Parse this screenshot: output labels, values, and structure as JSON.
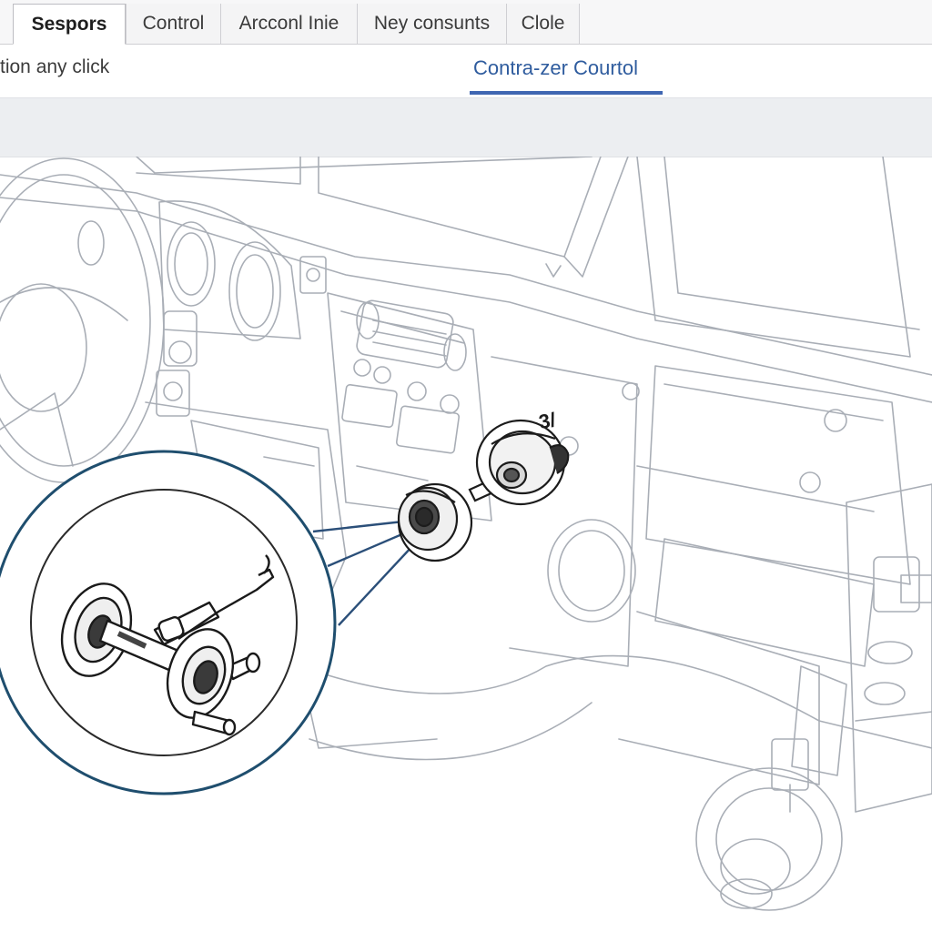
{
  "tabs": [
    {
      "label": "Sespors",
      "active": true
    },
    {
      "label": "Control",
      "active": false
    },
    {
      "label": "Arcconl Inie",
      "active": false
    },
    {
      "label": "Ney consunts",
      "active": false
    },
    {
      "label": "Clole",
      "active": false
    }
  ],
  "subbar": {
    "hint": "tion any click",
    "active_link": "Contra-zer Courtol"
  },
  "colors": {
    "accent": "#3f66b2",
    "callout_ring": "#1f4e6e",
    "line_art": "#a9aeb6"
  },
  "diagram": {
    "part_label": "3/"
  }
}
